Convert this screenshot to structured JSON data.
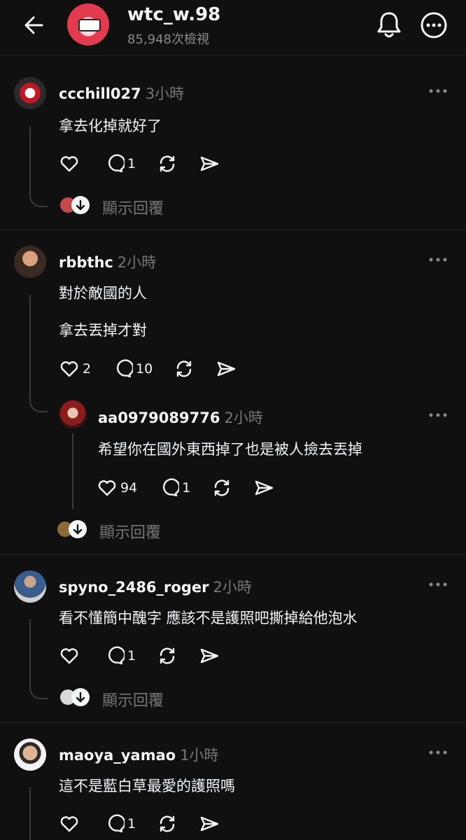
{
  "header": {
    "name": "wtc_w.98",
    "views": "85,948次檢視"
  },
  "comments": [
    {
      "user": "ccchill027",
      "time": "3小時",
      "lines": [
        "拿去化掉就好了"
      ],
      "likes": "",
      "replies": "1",
      "show_replies": "顯示回覆"
    },
    {
      "user": "rbbthc",
      "time": "2小時",
      "lines": [
        "對於敵國的人",
        "拿去丟掉才對"
      ],
      "likes": "2",
      "replies": "10",
      "reply": {
        "user": "aa0979089776",
        "time": "2小時",
        "lines": [
          "希望你在國外東西掉了也是被人撿去丟掉"
        ],
        "likes": "94",
        "replies": "1"
      },
      "show_replies": "顯示回覆"
    },
    {
      "user": "spyno_2486_roger",
      "time": "2小時",
      "lines": [
        "看不懂簡中醜字 應該不是護照吧撕掉給他泡水"
      ],
      "likes": "",
      "replies": "1",
      "show_replies": "顯示回覆"
    },
    {
      "user": "maoya_yamao",
      "time": "1小時",
      "lines": [
        "這不是藍白草最愛的護照嗎"
      ],
      "likes": "",
      "replies": "1"
    }
  ]
}
